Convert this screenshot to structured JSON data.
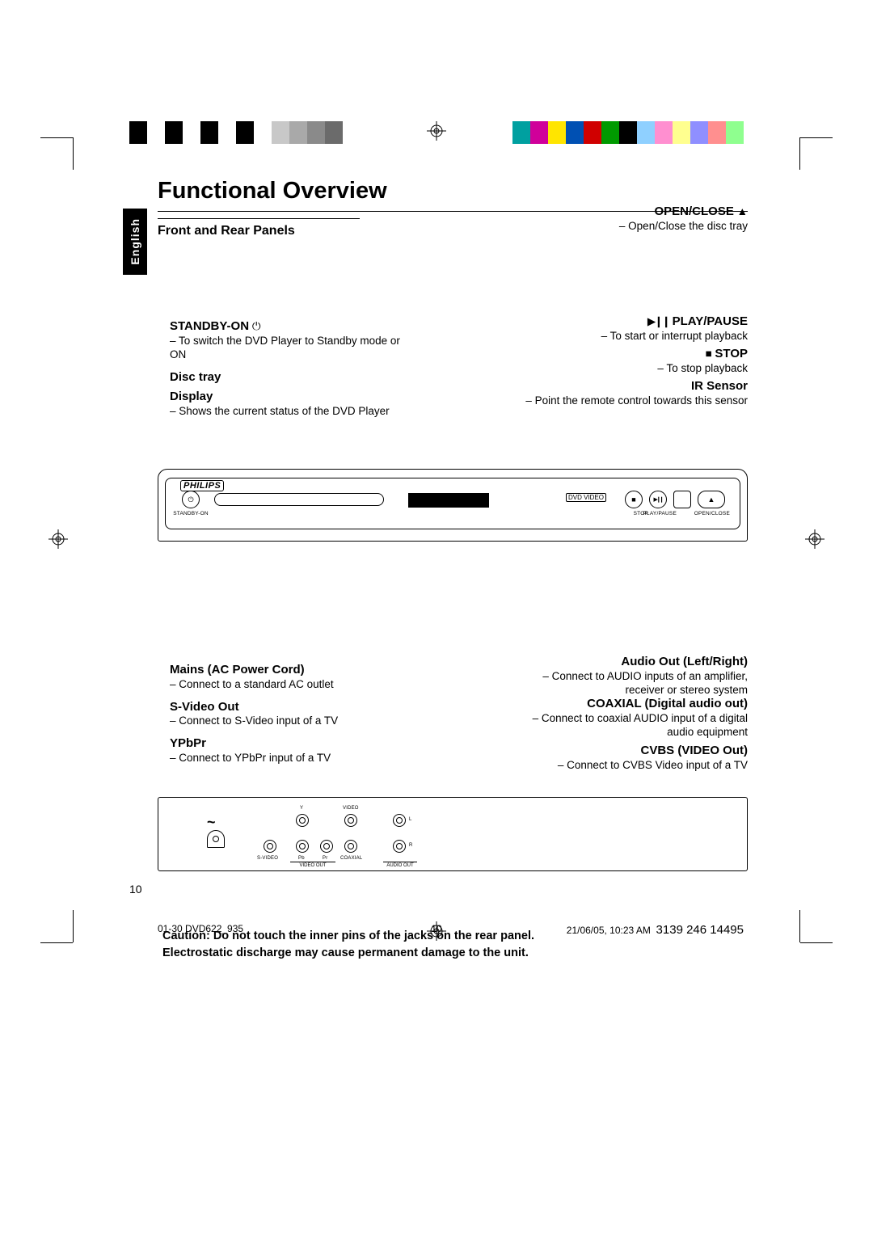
{
  "language_tab": "English",
  "page_title": "Functional Overview",
  "section_title": "Front and Rear Panels",
  "front": {
    "standby_on": {
      "label": "STANDBY-ON",
      "desc": "To switch the DVD Player to Standby mode or ON"
    },
    "disc_tray": {
      "label": "Disc tray"
    },
    "display": {
      "label": "Display",
      "desc": "Shows the current status of the DVD Player"
    },
    "open_close": {
      "label": "OPEN/CLOSE",
      "desc": "Open/Close the disc tray"
    },
    "play_pause": {
      "label": "PLAY/PAUSE",
      "desc": "To start or interrupt playback"
    },
    "stop": {
      "label": "STOP",
      "desc": "To stop playback"
    },
    "ir_sensor": {
      "label": "IR Sensor",
      "desc": "Point the remote control towards this sensor"
    },
    "brand": "PHILIPS",
    "dvd_logo": "DVD VIDEO",
    "btn_labels": {
      "standby": "STANDBY-ON",
      "stop": "STOP",
      "playpause": "PLAY/PAUSE",
      "openclose": "OPEN/CLOSE"
    }
  },
  "rear": {
    "mains": {
      "label": "Mains (AC Power Cord)",
      "desc": "Connect to a standard AC outlet"
    },
    "svideo": {
      "label": "S-Video Out",
      "desc": "Connect to S-Video input of a TV"
    },
    "ypbpr": {
      "label": "YPbPr",
      "desc": "Connect to YPbPr input of a TV"
    },
    "audio": {
      "label": "Audio Out (Left/Right)",
      "desc": "Connect to AUDIO inputs of an amplifier, receiver or stereo system"
    },
    "coaxial": {
      "label": "COAXIAL (Digital audio out)",
      "desc": "Connect to coaxial AUDIO input of a digital audio equipment"
    },
    "cvbs": {
      "label": "CVBS (VIDEO Out)",
      "desc": "Connect to CVBS Video input of a TV"
    },
    "jack_labels": {
      "svideo": "S-VIDEO",
      "videoout": "VIDEO OUT",
      "y": "Y",
      "pb": "Pb",
      "pr": "Pr",
      "video": "VIDEO",
      "coaxial": "COAXIAL",
      "audioout": "AUDIO OUT",
      "l": "L",
      "r": "R"
    }
  },
  "caution": {
    "line1": "Caution: Do not touch the inner pins of the jacks on the rear panel.",
    "line2": "Electrostatic discharge may cause permanent damage to the unit."
  },
  "page_number_main": "10",
  "imprint": {
    "left": "01-30 DVD622_935",
    "center": "10",
    "right_date": "21/06/05, 10:23 AM",
    "right_code": "3139 246 14495"
  },
  "color_patches": {
    "left": [
      "#000",
      "#fff",
      "#000",
      "#fff",
      "#000",
      "#fff",
      "#000",
      "#fff",
      "#c8c8c8",
      "#a9a9a9",
      "#8a8a8a",
      "#6b6b6b",
      "#fff"
    ],
    "right": [
      "#00a0a0",
      "#d0009a",
      "#ffe500",
      "#0050b3",
      "#d00000",
      "#009a00",
      "#000",
      "#8fd0ff",
      "#ff8fd0",
      "#ffff8f",
      "#8f8fff",
      "#ff8f8f",
      "#8fff8f"
    ]
  }
}
